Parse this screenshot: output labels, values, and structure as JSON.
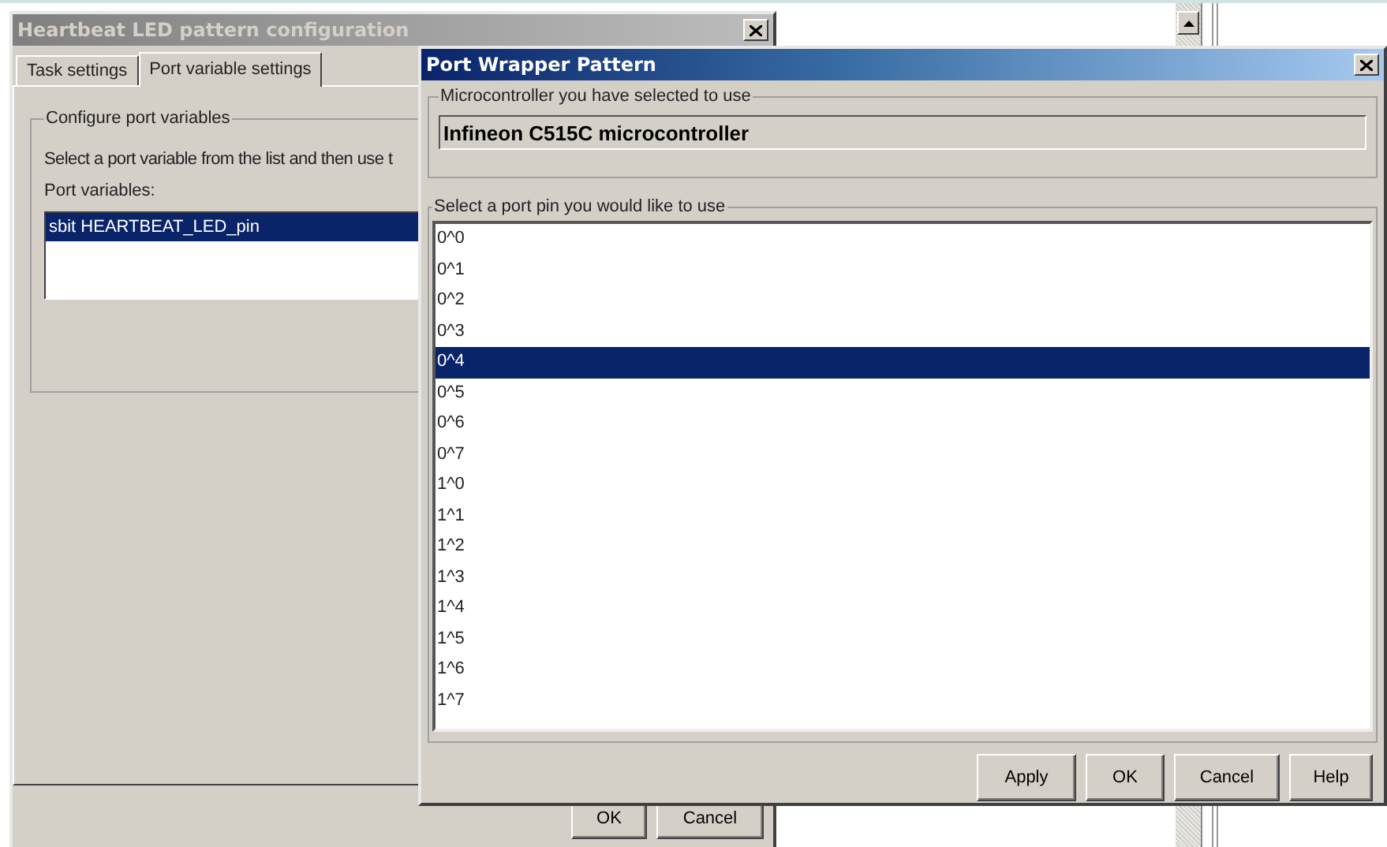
{
  "background_window": {
    "title": "Heartbeat LED pattern configuration",
    "tabs": [
      {
        "label": "Task settings",
        "selected": false
      },
      {
        "label": "Port variable settings",
        "selected": true
      }
    ],
    "group_title": "Configure port variables",
    "instruction": "Select a port variable from the list and then use t",
    "list_label": "Port variables:",
    "port_variables": [
      {
        "label": "sbit HEARTBEAT_LED_pin",
        "selected": true
      }
    ],
    "buttons": [
      "OK",
      "Cancel"
    ]
  },
  "dialog": {
    "title": "Port Wrapper Pattern",
    "microcontroller_group": "Microcontroller you have selected to use",
    "microcontroller": "Infineon C515C microcontroller",
    "pin_group": "Select a port pin you would like to use",
    "pins": [
      {
        "label": "0^0",
        "selected": false
      },
      {
        "label": "0^1",
        "selected": false
      },
      {
        "label": "0^2",
        "selected": false
      },
      {
        "label": "0^3",
        "selected": false
      },
      {
        "label": "0^4",
        "selected": true
      },
      {
        "label": "0^5",
        "selected": false
      },
      {
        "label": "0^6",
        "selected": false
      },
      {
        "label": "0^7",
        "selected": false
      },
      {
        "label": "1^0",
        "selected": false
      },
      {
        "label": "1^1",
        "selected": false
      },
      {
        "label": "1^2",
        "selected": false
      },
      {
        "label": "1^3",
        "selected": false
      },
      {
        "label": "1^4",
        "selected": false
      },
      {
        "label": "1^5",
        "selected": false
      },
      {
        "label": "1^6",
        "selected": false
      },
      {
        "label": "1^7",
        "selected": false
      }
    ],
    "buttons": [
      "Apply",
      "OK",
      "Cancel",
      "Help"
    ]
  }
}
